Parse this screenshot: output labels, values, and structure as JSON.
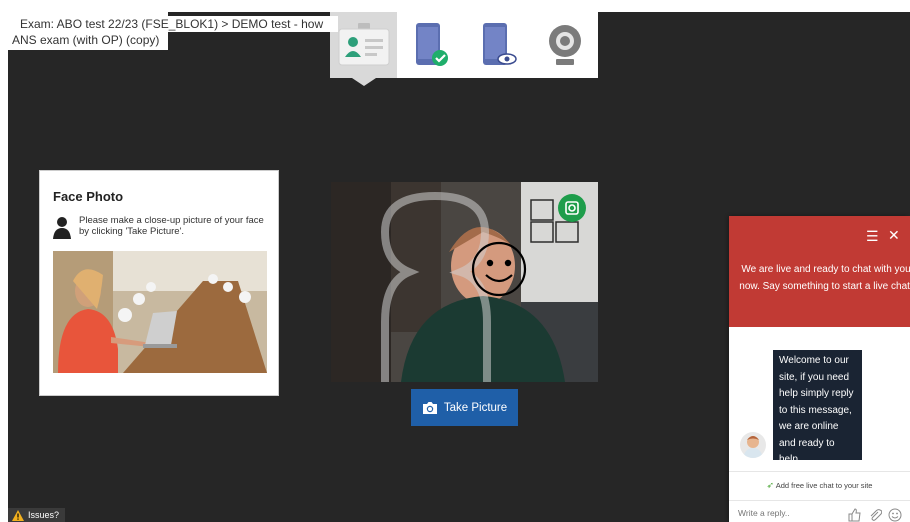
{
  "exam": {
    "title_line1": "Exam: ABO test 22/23 (FSE_BLOK1) > DEMO test -  how",
    "title_line2": "ANS exam (with OP) (copy)"
  },
  "steps": [
    {
      "icon": "id-card-icon",
      "active": true
    },
    {
      "icon": "phone-check-icon",
      "active": false
    },
    {
      "icon": "phone-eye-icon",
      "active": false
    },
    {
      "icon": "webcam-icon",
      "active": false
    }
  ],
  "face_photo": {
    "title": "Face Photo",
    "instruction": "Please make a close-up picture of your face by clicking 'Take Picture'."
  },
  "camera": {
    "button_label": "Take Picture"
  },
  "chat": {
    "header_text": "We are live and ready to chat with you now. Say something to start a live chat.",
    "message": "Welcome to our site, if you need help simply reply to this message, we are online and ready to help.",
    "promo": "Add free live chat to your site",
    "input_placeholder": "Write a reply.."
  },
  "issues": {
    "label": "Issues?"
  },
  "colors": {
    "background": "#262626",
    "chat_header": "#c13a34",
    "button_blue": "#1f5fa8",
    "badge_green": "#1e9d4b",
    "chat_bubble": "#1a2433"
  }
}
